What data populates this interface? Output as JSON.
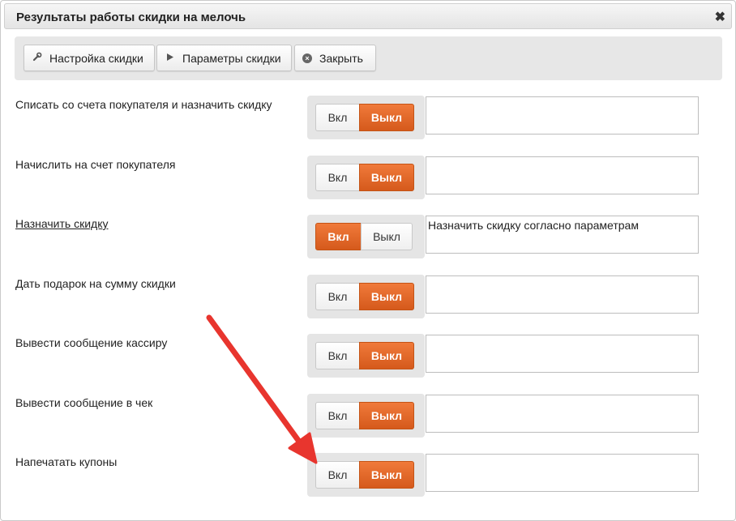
{
  "dialog": {
    "title": "Результаты работы скидки на мелочь",
    "close_glyph": "✖"
  },
  "toolbar": {
    "settings_label": "Настройка скидки",
    "params_label": "Параметры скидки",
    "close_label": "Закрыть"
  },
  "toggle": {
    "on_label": "Вкл",
    "off_label": "Выкл"
  },
  "rows": [
    {
      "label": "Списать со счета покупателя и назначить скидку",
      "state": "off",
      "text": "",
      "link": false
    },
    {
      "label": "Начислить на счет покупателя",
      "state": "off",
      "text": "",
      "link": false
    },
    {
      "label": "Назначить скидку",
      "state": "on",
      "text": "Назначить скидку согласно параметрам",
      "link": true
    },
    {
      "label": "Дать подарок на сумму скидки",
      "state": "off",
      "text": "",
      "link": false
    },
    {
      "label": "Вывести сообщение кассиру",
      "state": "off",
      "text": "",
      "link": false
    },
    {
      "label": "Вывести сообщение в чек",
      "state": "off",
      "text": "",
      "link": false
    },
    {
      "label": "Напечатать купоны",
      "state": "off",
      "text": "",
      "link": false
    }
  ],
  "colors": {
    "accent": "#e0652a",
    "arrow": "#e8352e"
  }
}
